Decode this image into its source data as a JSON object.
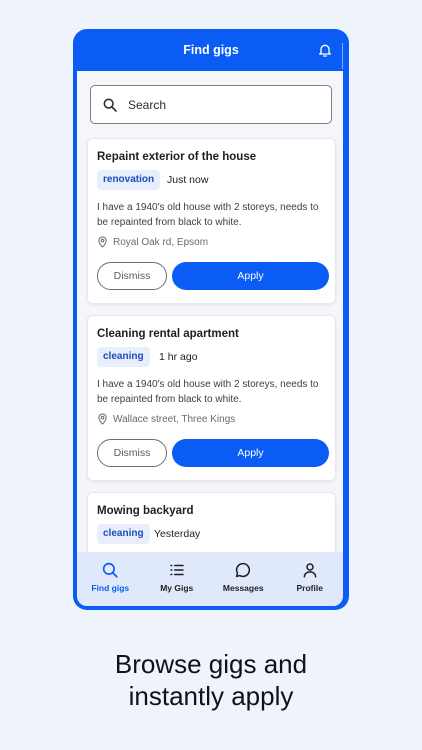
{
  "header": {
    "title": "Find gigs",
    "icon": "bell-icon"
  },
  "search": {
    "placeholder": "Search",
    "icon": "search-icon"
  },
  "gigs": [
    {
      "title": "Repaint exterior of the house",
      "tag": "renovation",
      "time": "Just now",
      "description": "I have a 1940's old house with 2 storeys, needs to be repainted from black to white.",
      "location": "Royal Oak rd, Epsom",
      "dismiss": "Dismiss",
      "apply": "Apply"
    },
    {
      "title": "Cleaning rental apartment",
      "tag": "cleaning",
      "time": "1 hr ago",
      "description": "I have a 1940's old house with 2 storeys, needs to be repainted from black to white.",
      "location": "Wallace street, Three Kings",
      "dismiss": "Dismiss",
      "apply": "Apply"
    },
    {
      "title": "Mowing backyard",
      "tag": "cleaning",
      "time": "Yesterday"
    }
  ],
  "nav": [
    {
      "label": "Find gigs",
      "icon": "search-icon",
      "active": true
    },
    {
      "label": "My Gigs",
      "icon": "list-icon",
      "active": false
    },
    {
      "label": "Messages",
      "icon": "chat-bubble-icon",
      "active": false
    },
    {
      "label": "Profile",
      "icon": "person-icon",
      "active": false
    }
  ],
  "caption": {
    "line1": "Browse gigs and",
    "line2": "instantly apply"
  },
  "colors": {
    "primary": "#0a5cf5",
    "tag_bg": "#e8eefc",
    "nav_bg": "#dfe9fb",
    "page_bg": "#eef3fc"
  }
}
